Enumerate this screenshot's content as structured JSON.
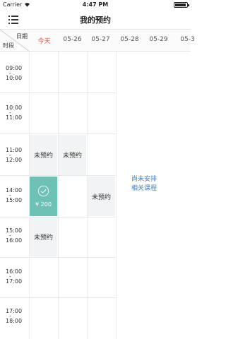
{
  "status_bar": {
    "carrier": "Carrier",
    "time": "4:47 PM"
  },
  "nav": {
    "title": "我的预约"
  },
  "grid_header": {
    "date_label": "日期",
    "time_label": "时段",
    "days": [
      "今天",
      "05-26",
      "05-27",
      "05-28",
      "05-29",
      "05-3"
    ]
  },
  "time_slots": [
    {
      "start": "09:00",
      "end": "10:00"
    },
    {
      "start": "10:00",
      "end": "11:00"
    },
    {
      "start": "11:00",
      "end": "12:00"
    },
    {
      "start": "14:00",
      "end": "15:00"
    },
    {
      "start": "15:00",
      "end": "16:00"
    },
    {
      "start": "16:00",
      "end": "17:00"
    },
    {
      "start": "17:00",
      "end": "18:00"
    }
  ],
  "slots": {
    "today_1100": "未预约",
    "d0526_1100": "未预约",
    "today_1400_price": "¥ 200",
    "d0527_1400": "未预约",
    "today_1500": "未预约"
  },
  "no_course": {
    "line1": "尚未安排",
    "line2": "相关课程"
  },
  "colors": {
    "accent": "#6ec1b5",
    "today": "#e8493f",
    "link": "#3d7fc1"
  }
}
